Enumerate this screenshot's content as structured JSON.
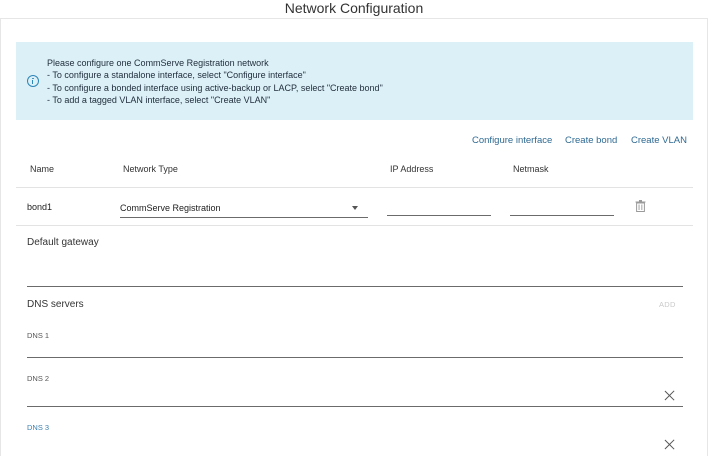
{
  "window": {
    "title": "Network Configuration"
  },
  "info_banner": {
    "lines": [
      "Please configure one CommServe Registration network",
      "- To configure a standalone interface, select \"Configure interface\"",
      "- To configure a bonded interface using active-backup or LACP, select \"Create bond\"",
      "- To add a tagged VLAN interface, select \"Create VLAN\""
    ]
  },
  "actions": {
    "configure_interface": "Configure interface",
    "create_bond": "Create bond",
    "create_vlan": "Create VLAN"
  },
  "table": {
    "columns": [
      "Name",
      "Network Type",
      "IP Address",
      "Netmask"
    ],
    "rows": [
      {
        "name": "bond1",
        "network_type": "CommServe Registration",
        "ip_address": "",
        "netmask": ""
      }
    ]
  },
  "default_gateway": {
    "label": "Default gateway",
    "value": ""
  },
  "dns": {
    "label": "DNS servers",
    "add_label": "ADD",
    "add_enabled": false,
    "fields": [
      {
        "label": "DNS 1",
        "value": ""
      },
      {
        "label": "DNS 2",
        "value": ""
      },
      {
        "label": "DNS 3",
        "value": ""
      }
    ]
  },
  "colors": {
    "info_bg": "#dcf0f8",
    "info_icon": "#2c86b8",
    "action_link": "#2f6a93",
    "focused_label": "#3a7fb0"
  },
  "icons": {
    "info": "info-circle-icon",
    "dropdown": "caret-down-icon",
    "delete": "trash-icon",
    "clear": "close-icon"
  }
}
